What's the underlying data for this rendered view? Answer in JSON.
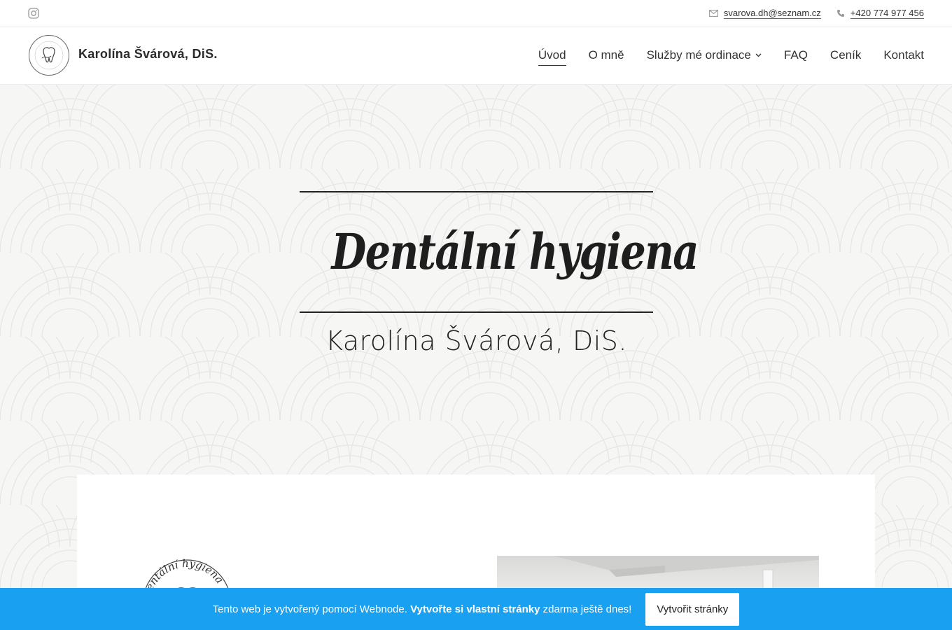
{
  "topbar": {
    "instagram_icon": "instagram-icon",
    "email": "svarova.dh@seznam.cz",
    "phone": "+420 774 977 456"
  },
  "header": {
    "brand": "Karolína Švárová, DiS.",
    "nav": [
      {
        "label": "Úvod",
        "active": true
      },
      {
        "label": "O mně",
        "active": false
      },
      {
        "label": "Služby mé ordinace",
        "active": false,
        "dropdown": true
      },
      {
        "label": "FAQ",
        "active": false
      },
      {
        "label": "Ceník",
        "active": false
      },
      {
        "label": "Kontakt",
        "active": false
      }
    ]
  },
  "hero": {
    "title": "Dentální hygiena",
    "subtitle": "Karolína Švárová, DiS."
  },
  "card": {
    "logo_text": "Dentální hygiena"
  },
  "webnode": {
    "text_prefix": "Tento web je vytvořený pomocí Webnode. ",
    "text_bold": "Vytvořte si vlastní stránky",
    "text_suffix": " zdarma ještě dnes!",
    "button": "Vytvořit stránky"
  },
  "colors": {
    "accent": "#1aa0f0",
    "hero_bg": "#f6f6f5",
    "text": "#222222"
  }
}
